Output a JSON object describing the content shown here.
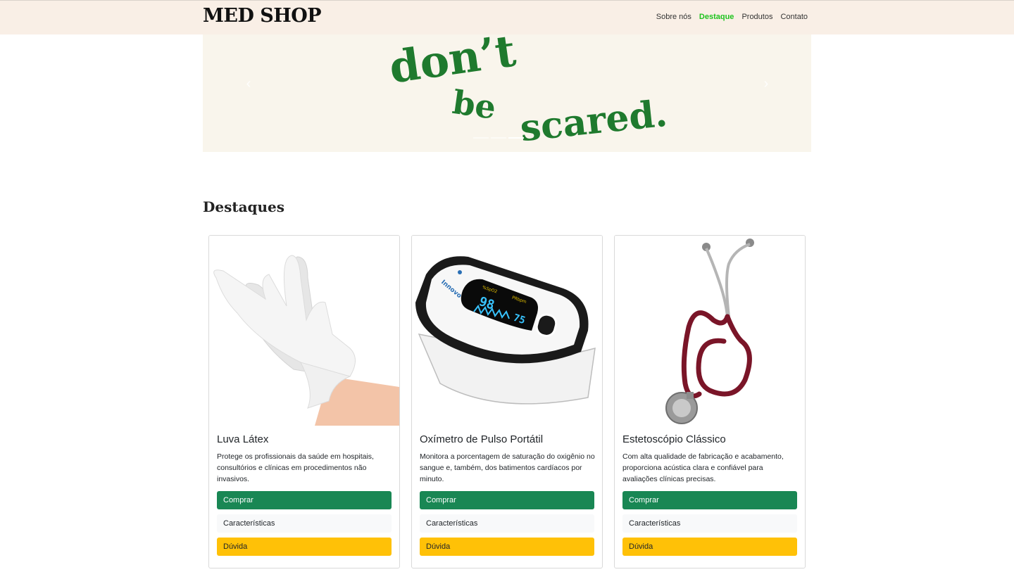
{
  "navbar": {
    "brand": "MED SHOP",
    "links": [
      {
        "label": "Sobre nós",
        "active": false
      },
      {
        "label": "Destaque",
        "active": true
      },
      {
        "label": "Produtos",
        "active": false
      },
      {
        "label": "Contato",
        "active": false
      }
    ]
  },
  "carousel": {
    "banner_text": "don't be scared.",
    "prev_icon": "chevron-left-icon",
    "next_icon": "chevron-right-icon",
    "active_slide": 3,
    "slide_count": 3
  },
  "section": {
    "title": "Destaques"
  },
  "products": [
    {
      "name": "Luva Látex",
      "description": "Protege os profissionais da saúde em hospitais, consultórios e clínicas em procedimentos não invasivos.",
      "buy_label": "Comprar",
      "features_label": "Características",
      "question_label": "Dúvida"
    },
    {
      "name": "Oxímetro de Pulso Portátil",
      "description": "Monitora a porcentagem de saturação do oxigênio no sangue e, também, dos batimentos cardíacos por minuto.",
      "buy_label": "Comprar",
      "features_label": "Características",
      "question_label": "Dúvida",
      "device": {
        "brand": "Innovo",
        "spo2_label": "%SpO2",
        "pr_label": "PRbpm",
        "spo2_value": "98",
        "pr_value": "75"
      }
    },
    {
      "name": "Estetoscópio Clássico",
      "description": "Com alta qualidade de fabricação e acabamento, proporciona acústica clara e confiável para avaliações clínicas precisas.",
      "buy_label": "Comprar",
      "features_label": "Características",
      "question_label": "Dúvida"
    }
  ],
  "colors": {
    "navbar_bg": "#f9efe6",
    "active_link": "#1ec31e",
    "buy_button": "#198754",
    "question_button": "#ffc107",
    "banner_green": "#1f7a2e"
  }
}
